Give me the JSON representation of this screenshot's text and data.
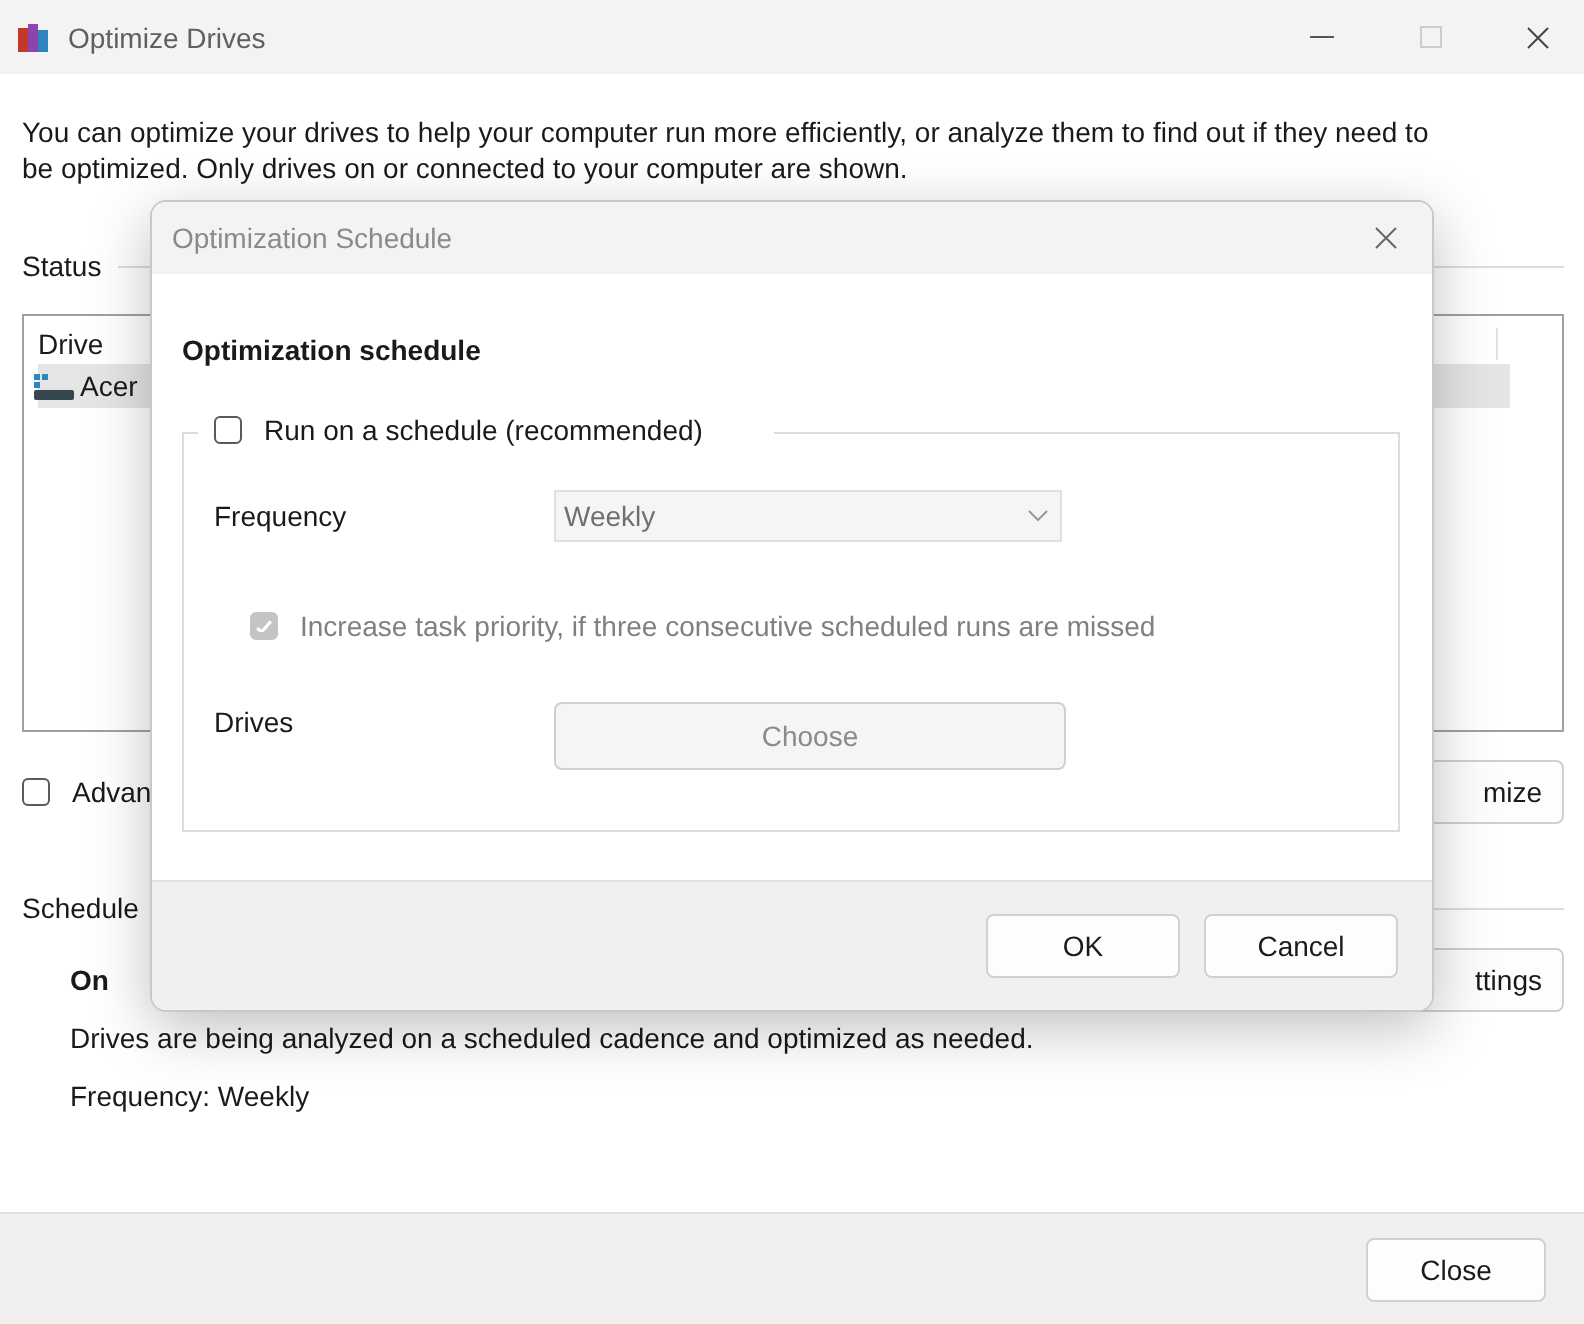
{
  "window": {
    "title": "Optimize Drives"
  },
  "description": "You can optimize your drives to help your computer run more efficiently, or analyze them to find out if they need to be optimized. Only drives on or connected to your computer are shown.",
  "status": {
    "heading": "Status",
    "columns": [
      "Drive"
    ],
    "rows": [
      {
        "name": "Acer",
        "selected": true
      }
    ]
  },
  "advanced": {
    "label": "Advan",
    "checked": false
  },
  "optimize_button": "mize",
  "scheduled": {
    "heading": "Schedule",
    "state": "On",
    "description": "Drives are being analyzed on a scheduled cadence and optimized as needed.",
    "frequency": "Frequency: Weekly",
    "settings_button": "ttings"
  },
  "close_button": "Close",
  "dialog": {
    "title": "Optimization Schedule",
    "heading": "Optimization schedule",
    "run_on_schedule": {
      "label": "Run on a schedule (recommended)",
      "checked": false
    },
    "frequency": {
      "label": "Frequency",
      "value": "Weekly",
      "disabled": true
    },
    "increase_priority": {
      "label": "Increase task priority, if three consecutive scheduled runs are missed",
      "checked": true,
      "disabled": true
    },
    "drives": {
      "label": "Drives",
      "button": "Choose",
      "disabled": true
    },
    "buttons": [
      "OK",
      "Cancel"
    ]
  }
}
